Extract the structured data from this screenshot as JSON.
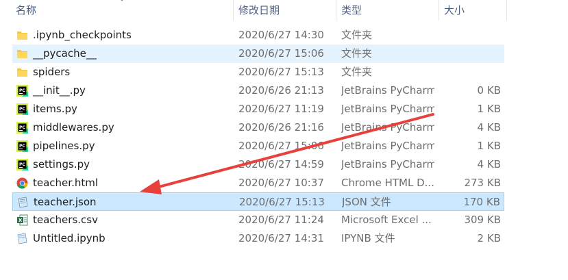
{
  "header": {
    "col_name": "名称",
    "col_date": "修改日期",
    "col_type": "类型",
    "col_size": "大小"
  },
  "files": [
    {
      "name": ".ipynb_checkpoints",
      "date": "2020/6/27 14:30",
      "type": "文件夹",
      "size": "",
      "icon": "folder-icon",
      "state": "normal"
    },
    {
      "name": "__pycache__",
      "date": "2020/6/27 15:06",
      "type": "文件夹",
      "size": "",
      "icon": "folder-icon",
      "state": "hover"
    },
    {
      "name": "spiders",
      "date": "2020/6/27 15:13",
      "type": "文件夹",
      "size": "",
      "icon": "folder-icon",
      "state": "normal"
    },
    {
      "name": "__init__.py",
      "date": "2020/6/26 21:13",
      "type": "JetBrains PyCharm",
      "size": "0 KB",
      "icon": "pycharm-icon",
      "state": "normal"
    },
    {
      "name": "items.py",
      "date": "2020/6/27 11:19",
      "type": "JetBrains PyCharm",
      "size": "1 KB",
      "icon": "pycharm-icon",
      "state": "normal"
    },
    {
      "name": "middlewares.py",
      "date": "2020/6/26 21:16",
      "type": "JetBrains PyCharm",
      "size": "4 KB",
      "icon": "pycharm-icon",
      "state": "normal"
    },
    {
      "name": "pipelines.py",
      "date": "2020/6/27 15:06",
      "type": "JetBrains PyCharm",
      "size": "1 KB",
      "icon": "pycharm-icon",
      "state": "normal"
    },
    {
      "name": "settings.py",
      "date": "2020/6/27 14:59",
      "type": "JetBrains PyCharm",
      "size": "4 KB",
      "icon": "pycharm-icon",
      "state": "normal"
    },
    {
      "name": "teacher.html",
      "date": "2020/6/27 10:37",
      "type": "Chrome HTML D...",
      "size": "273 KB",
      "icon": "chrome-icon",
      "state": "normal"
    },
    {
      "name": "teacher.json",
      "date": "2020/6/27 15:13",
      "type": "JSON 文件",
      "size": "170 KB",
      "icon": "json-file-icon",
      "state": "selected"
    },
    {
      "name": "teachers.csv",
      "date": "2020/6/27 11:24",
      "type": "Microsoft Excel ...",
      "size": "309 KB",
      "icon": "excel-icon",
      "state": "normal"
    },
    {
      "name": "Untitled.ipynb",
      "date": "2020/6/27 14:31",
      "type": "IPYNB 文件",
      "size": "2 KB",
      "icon": "generic-file-icon",
      "state": "normal"
    }
  ],
  "colors": {
    "hover_bg": "#e5f3ff",
    "selected_bg": "#cce8ff",
    "annotation_arrow": "#e8413b"
  }
}
